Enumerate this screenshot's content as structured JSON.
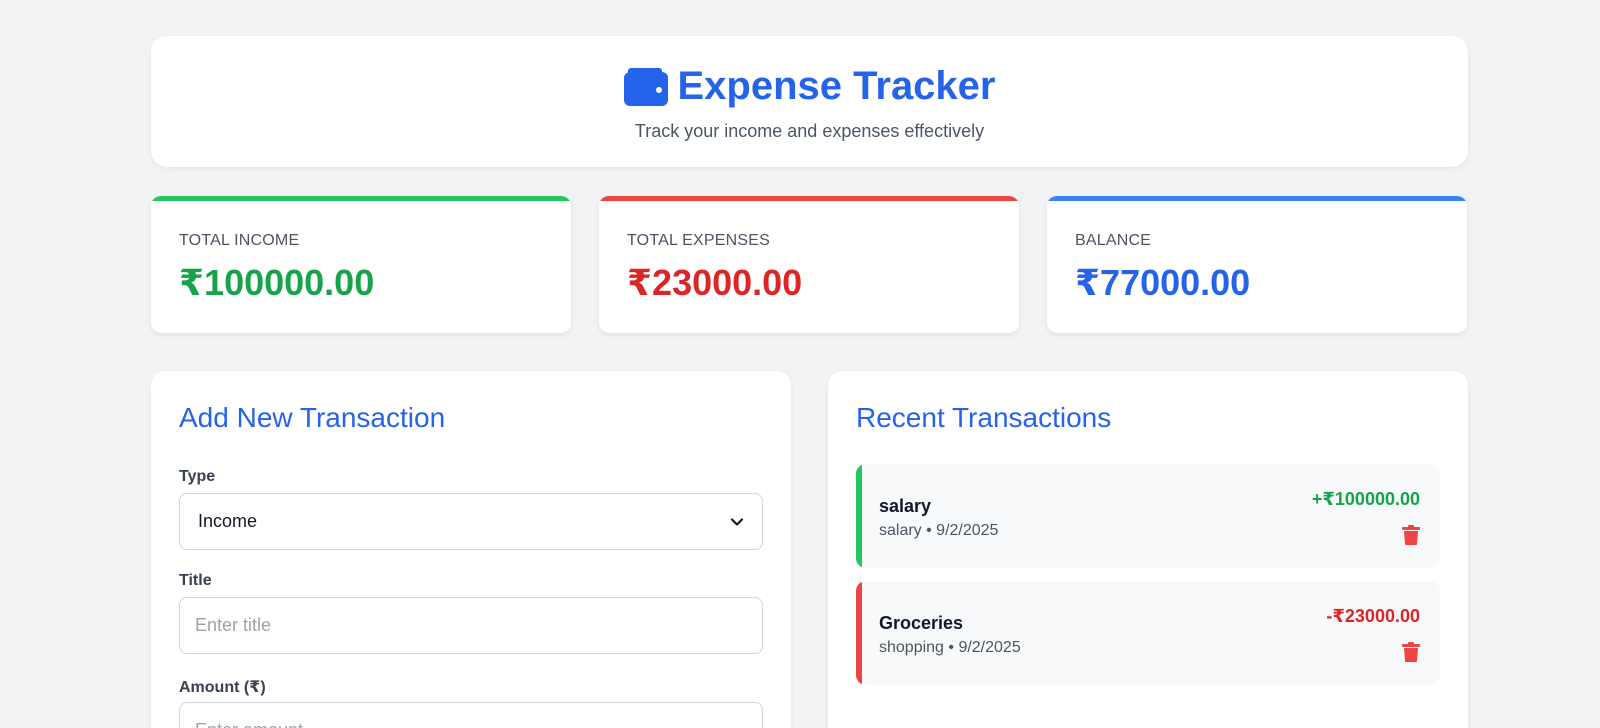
{
  "header": {
    "title": "Expense Tracker",
    "subtitle": "Track your income and expenses effectively",
    "icon": "wallet-icon"
  },
  "summary": {
    "income": {
      "label": "TOTAL INCOME",
      "value": "₹100000.00",
      "color": "#16a34a"
    },
    "expenses": {
      "label": "TOTAL EXPENSES",
      "value": "₹23000.00",
      "color": "#dc2626"
    },
    "balance": {
      "label": "BALANCE",
      "value": "₹77000.00",
      "color": "#2563eb"
    }
  },
  "form": {
    "title": "Add New Transaction",
    "type_label": "Type",
    "type_value": "Income",
    "title_label": "Title",
    "title_placeholder": "Enter title",
    "amount_label": "Amount (₹)",
    "amount_placeholder": "Enter amount"
  },
  "transactions": {
    "title": "Recent Transactions",
    "items": [
      {
        "title": "salary",
        "meta": "salary • 9/2/2025",
        "amount": "+₹100000.00",
        "kind": "income"
      },
      {
        "title": "Groceries",
        "meta": "shopping • 9/2/2025",
        "amount": "-₹23000.00",
        "kind": "expense"
      }
    ]
  },
  "colors": {
    "accent": "#2563eb",
    "income": "#16a34a",
    "expense": "#dc2626",
    "income_edge": "#22c55e",
    "expense_edge": "#ef4444",
    "trash": "#ef4444"
  }
}
